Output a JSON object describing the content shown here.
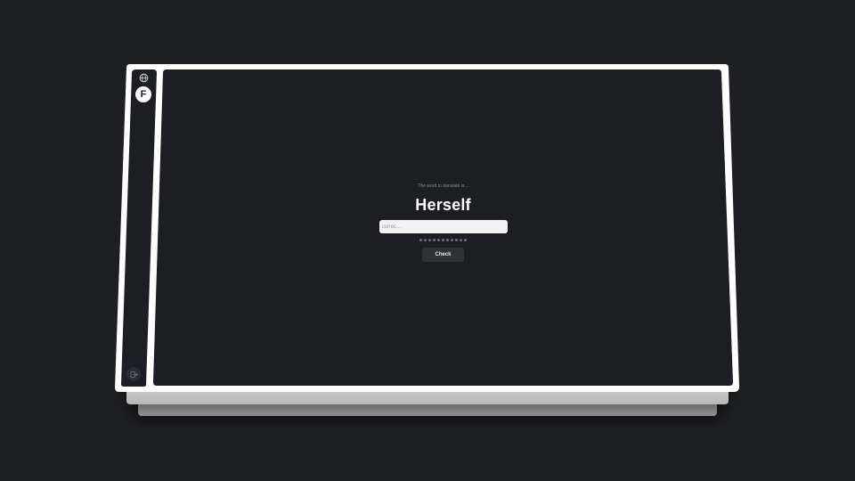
{
  "colors": {
    "background": "#1e1f23",
    "frame": "#ffffff",
    "screen": "#1d1e23",
    "text_primary": "#ffffff",
    "text_muted": "#8c8e96",
    "button": "#303137"
  },
  "sidebar": {
    "top_icon": "globe-icon",
    "avatar_letter": "F",
    "bottom_icon": "logout-icon"
  },
  "quiz": {
    "prompt": "The word to translate is...",
    "word": "Herself",
    "input_placeholder": "correc...",
    "input_value": "",
    "progress_total": 11,
    "progress_completed": 0,
    "check_label": "Check"
  }
}
